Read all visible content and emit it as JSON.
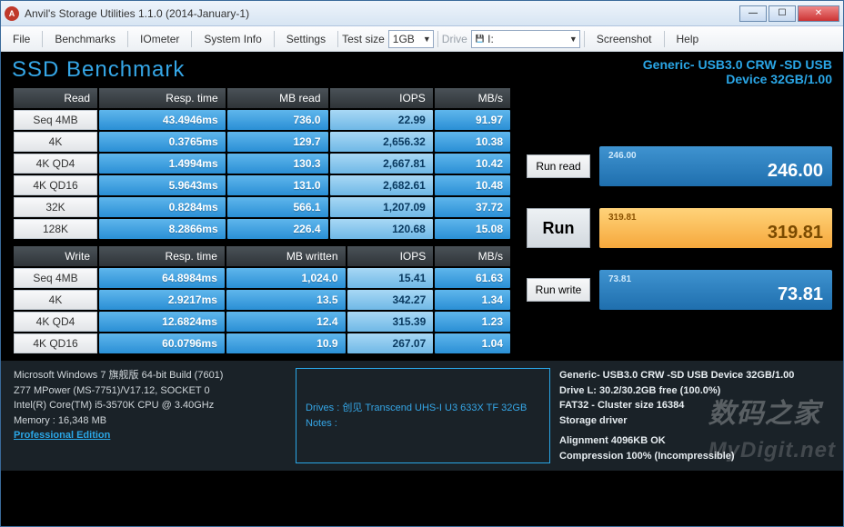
{
  "window": {
    "title": "Anvil's Storage Utilities 1.1.0 (2014-January-1)"
  },
  "menu": {
    "file": "File",
    "benchmarks": "Benchmarks",
    "iometer": "IOmeter",
    "system_info": "System Info",
    "settings": "Settings",
    "test_size_label": "Test size",
    "test_size_value": "1GB",
    "drive_label": "Drive",
    "drive_value": "I:",
    "screenshot": "Screenshot",
    "help": "Help"
  },
  "heading": {
    "title": "SSD Benchmark",
    "dev1": "Generic- USB3.0 CRW   -SD USB",
    "dev2": "Device 32GB/1.00"
  },
  "read": {
    "hdr": {
      "name": "Read",
      "resp": "Resp. time",
      "mb": "MB read",
      "iops": "IOPS",
      "mbs": "MB/s"
    },
    "rows": [
      {
        "name": "Seq 4MB",
        "resp": "43.4946ms",
        "mb": "736.0",
        "iops": "22.99",
        "mbs": "91.97"
      },
      {
        "name": "4K",
        "resp": "0.3765ms",
        "mb": "129.7",
        "iops": "2,656.32",
        "mbs": "10.38"
      },
      {
        "name": "4K QD4",
        "resp": "1.4994ms",
        "mb": "130.3",
        "iops": "2,667.81",
        "mbs": "10.42"
      },
      {
        "name": "4K QD16",
        "resp": "5.9643ms",
        "mb": "131.0",
        "iops": "2,682.61",
        "mbs": "10.48"
      },
      {
        "name": "32K",
        "resp": "0.8284ms",
        "mb": "566.1",
        "iops": "1,207.09",
        "mbs": "37.72"
      },
      {
        "name": "128K",
        "resp": "8.2866ms",
        "mb": "226.4",
        "iops": "120.68",
        "mbs": "15.08"
      }
    ]
  },
  "write": {
    "hdr": {
      "name": "Write",
      "resp": "Resp. time",
      "mb": "MB written",
      "iops": "IOPS",
      "mbs": "MB/s"
    },
    "rows": [
      {
        "name": "Seq 4MB",
        "resp": "64.8984ms",
        "mb": "1,024.0",
        "iops": "15.41",
        "mbs": "61.63"
      },
      {
        "name": "4K",
        "resp": "2.9217ms",
        "mb": "13.5",
        "iops": "342.27",
        "mbs": "1.34"
      },
      {
        "name": "4K QD4",
        "resp": "12.6824ms",
        "mb": "12.4",
        "iops": "315.39",
        "mbs": "1.23"
      },
      {
        "name": "4K QD16",
        "resp": "60.0796ms",
        "mb": "10.9",
        "iops": "267.07",
        "mbs": "1.04"
      }
    ]
  },
  "side": {
    "run_read": "Run read",
    "run": "Run",
    "run_write": "Run write",
    "read_small": "246.00",
    "read_big": "246.00",
    "total_small": "319.81",
    "total_big": "319.81",
    "write_small": "73.81",
    "write_big": "73.81"
  },
  "footer": {
    "os": "Microsoft Windows 7 旗舰版  64-bit Build (7601)",
    "mb": "Z77 MPower (MS-7751)/V17.12, SOCKET 0",
    "cpu": "Intel(R) Core(TM) i5-3570K CPU @ 3.40GHz",
    "mem": "Memory : 16,348 MB",
    "edition": "Professional Edition",
    "drives_label": "Drives :",
    "drives_value": "创见 Transcend UHS-I U3 633X TF 32GB",
    "notes": "Notes :",
    "r_dev": "Generic- USB3.0 CRW   -SD USB Device 32GB/1.00",
    "r_free": "Drive L: 30.2/30.2GB free (100.0%)",
    "r_fs": "FAT32 - Cluster size 16384",
    "r_drv": "Storage driver",
    "r_align": "Alignment 4096KB OK",
    "r_comp": "Compression 100% (Incompressible)"
  },
  "watermark": {
    "cn": "数码之家",
    "en": "MyDigit.net"
  }
}
